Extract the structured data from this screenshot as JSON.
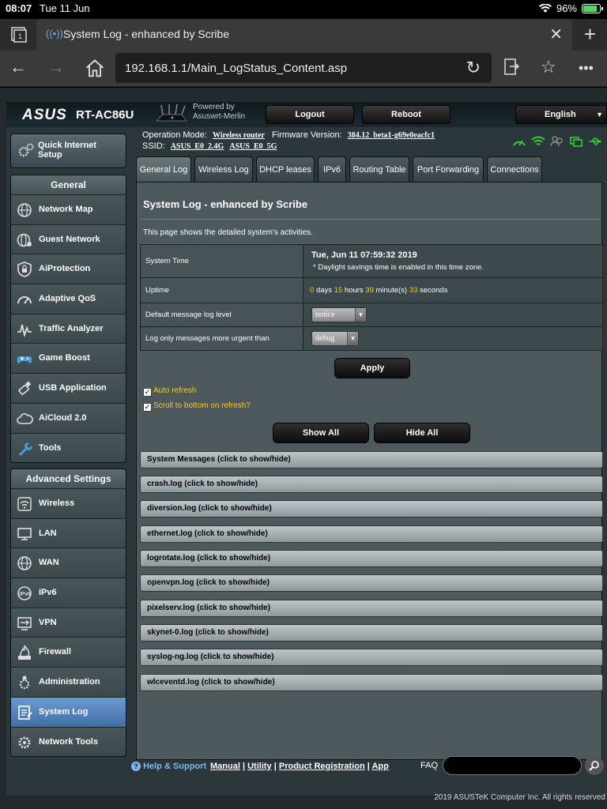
{
  "status_bar": {
    "time": "08:07",
    "date": "Tue 11 Jun",
    "battery": "96%"
  },
  "browser": {
    "tab_title": "System Log - enhanced by Scribe",
    "url": "192.168.1.1/Main_LogStatus_Content.asp"
  },
  "header": {
    "brand": "ASUS",
    "model": "RT-AC86U",
    "powered_line1": "Powered by",
    "powered_line2": "Asuswrt-Merlin",
    "logout_label": "Logout",
    "reboot_label": "Reboot",
    "language": "English"
  },
  "info": {
    "op_mode_label": "Operation Mode:",
    "op_mode_value": "Wireless router",
    "fw_label": "Firmware Version:",
    "fw_value": "384.12_beta1-g69e0eacfc1",
    "ssid_label": "SSID:",
    "ssid_1": "ASUS_E0_2.4G",
    "ssid_2": "ASUS_E0_5G"
  },
  "sidebar": {
    "qis_label_1": "Quick Internet",
    "qis_label_2": "Setup",
    "general_title": "General",
    "general_items": [
      {
        "label": "Network Map"
      },
      {
        "label": "Guest Network"
      },
      {
        "label": "AiProtection"
      },
      {
        "label": "Adaptive QoS"
      },
      {
        "label": "Traffic Analyzer"
      },
      {
        "label": "Game Boost"
      },
      {
        "label": "USB Application"
      },
      {
        "label": "AiCloud 2.0"
      },
      {
        "label": "Tools"
      }
    ],
    "advanced_title": "Advanced Settings",
    "advanced_items": [
      {
        "label": "Wireless"
      },
      {
        "label": "LAN"
      },
      {
        "label": "WAN"
      },
      {
        "label": "IPv6"
      },
      {
        "label": "VPN"
      },
      {
        "label": "Firewall"
      },
      {
        "label": "Administration"
      },
      {
        "label": "System Log"
      },
      {
        "label": "Network Tools"
      }
    ]
  },
  "tabs": [
    {
      "label": "General Log"
    },
    {
      "label": "Wireless Log"
    },
    {
      "label": "DHCP leases"
    },
    {
      "label": "IPv6"
    },
    {
      "label": "Routing Table"
    },
    {
      "label": "Port Forwarding"
    },
    {
      "label": "Connections"
    }
  ],
  "panel": {
    "title": "System Log - enhanced by Scribe",
    "description": "This page shows the detailed system's activities.",
    "system_time_label": "System Time",
    "system_time_value": "Tue, Jun 11 07:59:32 2019",
    "system_time_note": "* Daylight savings time is enabled in this time zone.",
    "uptime_label": "Uptime",
    "uptime_days": "0",
    "uptime_days_unit": "days",
    "uptime_hours": "15",
    "uptime_hours_unit": "hours",
    "uptime_minutes": "39",
    "uptime_minutes_unit": "minute(s)",
    "uptime_seconds": "33",
    "uptime_seconds_unit": "seconds",
    "msg_level_label": "Default message log level",
    "msg_level_value": "notice",
    "urgent_label": "Log only messages more urgent than",
    "urgent_value": "debug",
    "apply_label": "Apply",
    "auto_refresh_label": "Auto refresh",
    "scroll_bottom_label": "Scroll to bottom on refresh?",
    "show_all_label": "Show All",
    "hide_all_label": "Hide All",
    "logs": [
      "System Messages (click to show/hide)",
      "crash.log (click to show/hide)",
      "diversion.log (click to show/hide)",
      "ethernet.log (click to show/hide)",
      "logrotate.log (click to show/hide)",
      "openvpn.log (click to show/hide)",
      "pixelserv.log (click to show/hide)",
      "skynet-0.log (click to show/hide)",
      "syslog-ng.log (click to show/hide)",
      "wlceventd.log (click to show/hide)"
    ]
  },
  "footer": {
    "help": "Help & Support",
    "manual": "Manual",
    "utility": "Utility",
    "product_registration": "Product Registration",
    "app": "App",
    "faq": "FAQ",
    "copyright": "2019 ASUSTeK Computer Inc. All rights reserved"
  }
}
